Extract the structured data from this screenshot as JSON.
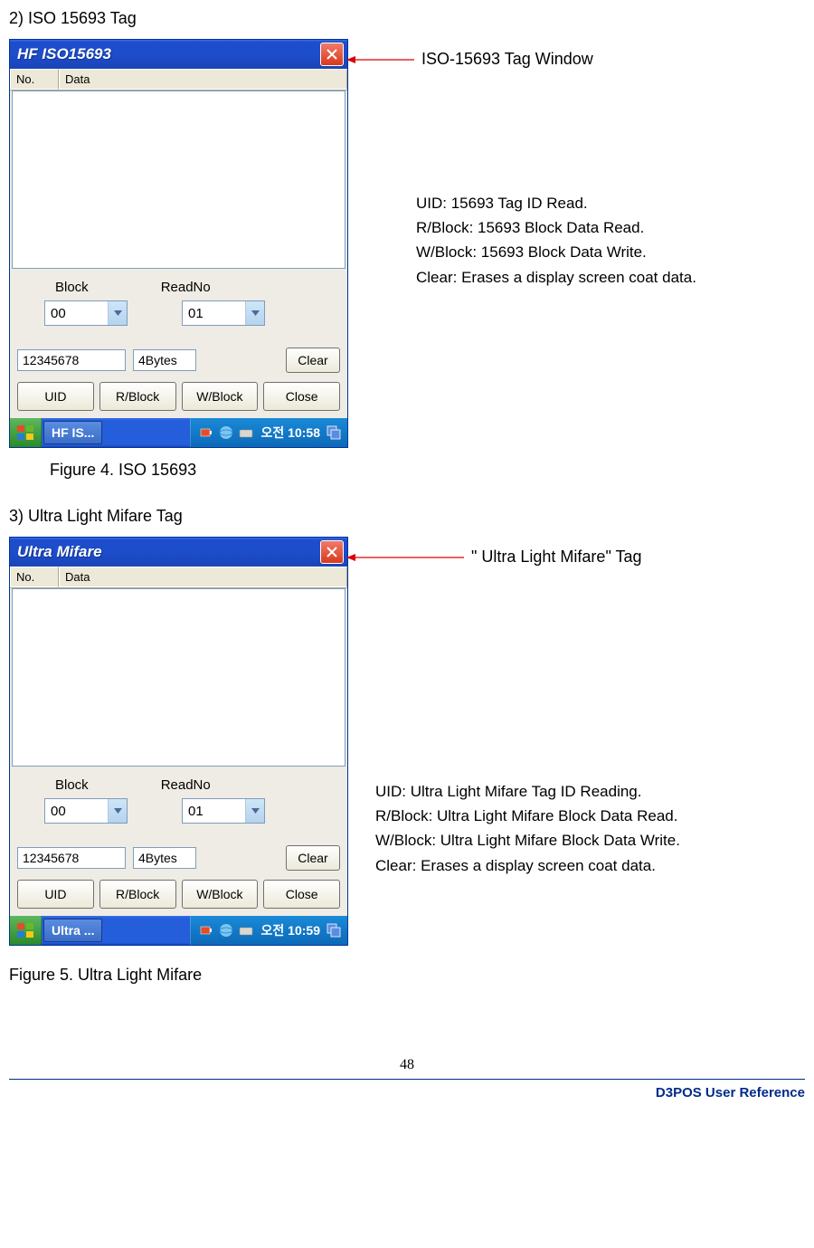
{
  "section1": {
    "heading": "2) ISO 15693 Tag",
    "callout": "ISO-15693 Tag Window",
    "window": {
      "title": "HF ISO15693",
      "columns": {
        "no": "No.",
        "data": "Data"
      },
      "labels": {
        "block": "Block",
        "readno": "ReadNo"
      },
      "inputs": {
        "block_value": "00",
        "readno_value": "01",
        "text1": "12345678",
        "text2": "4Bytes"
      },
      "buttons": {
        "clear": "Clear",
        "uid": "UID",
        "rblock": "R/Block",
        "wblock": "W/Block",
        "close": "Close"
      },
      "taskbar": {
        "task": "HF IS...",
        "time": "오전 10:58"
      }
    },
    "desc": {
      "l1": "UID: 15693 Tag ID Read.",
      "l2": "R/Block: 15693 Block Data Read.",
      "l3": "W/Block: 15693 Block Data Write.",
      "l4": "Clear: Erases a display screen coat data."
    },
    "caption": "Figure 4.   ISO 15693"
  },
  "section2": {
    "heading": "3) Ultra Light Mifare Tag",
    "callout": "\" Ultra Light Mifare\"  Tag",
    "window": {
      "title": "Ultra Mifare",
      "columns": {
        "no": "No.",
        "data": "Data"
      },
      "labels": {
        "block": "Block",
        "readno": "ReadNo"
      },
      "inputs": {
        "block_value": "00",
        "readno_value": "01",
        "text1": "12345678",
        "text2": "4Bytes"
      },
      "buttons": {
        "clear": "Clear",
        "uid": "UID",
        "rblock": "R/Block",
        "wblock": "W/Block",
        "close": "Close"
      },
      "taskbar": {
        "task": "Ultra ...",
        "time": "오전 10:59"
      }
    },
    "desc": {
      "l1": "UID: Ultra Light Mifare Tag ID Reading.",
      "l2": "R/Block: Ultra Light Mifare Block Data Read.",
      "l3": "W/Block: Ultra Light Mifare Block Data Write.",
      "l4": "Clear: Erases a display screen coat data."
    },
    "caption": "Figure 5. Ultra Light Mifare"
  },
  "footer": {
    "page": "48",
    "ref": "D3POS User Reference"
  }
}
